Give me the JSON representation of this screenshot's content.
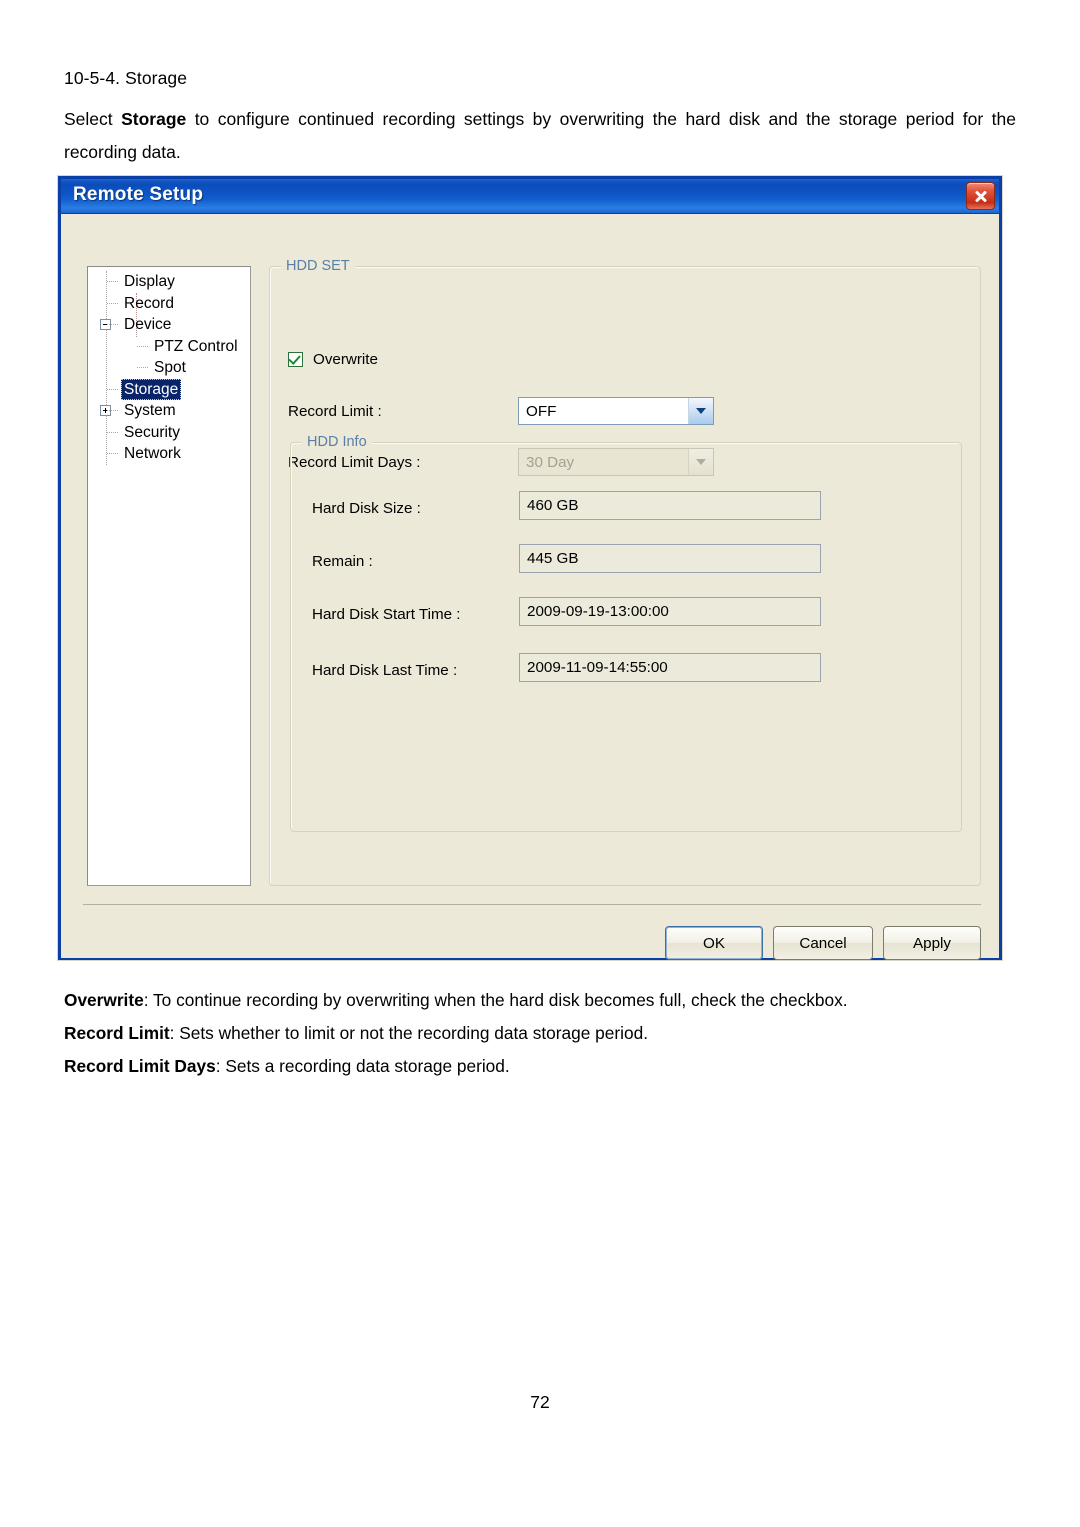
{
  "document": {
    "heading": "10-5-4. Storage",
    "intro_before": "Select ",
    "intro_bold": "Storage",
    "intro_after": " to configure continued recording settings by overwriting the hard disk and the storage period for the recording data.",
    "page_number": "72",
    "notes": [
      {
        "term": "Overwrite",
        "text": ": To continue recording by overwriting when the hard disk becomes full, check the checkbox."
      },
      {
        "term": "Record Limit",
        "text": ": Sets whether to limit or not the recording data storage period."
      },
      {
        "term": "Record Limit Days",
        "text": ": Sets a recording data storage period."
      }
    ]
  },
  "dialog": {
    "title": "Remote Setup",
    "close_icon": "close-icon",
    "tree": {
      "items": [
        {
          "label": "Display",
          "level": 1,
          "expander": "none",
          "selected": false
        },
        {
          "label": "Record",
          "level": 1,
          "expander": "none",
          "selected": false
        },
        {
          "label": "Device",
          "level": 1,
          "expander": "collapse",
          "selected": false
        },
        {
          "label": "PTZ Control",
          "level": 2,
          "expander": "none",
          "selected": false
        },
        {
          "label": "Spot",
          "level": 2,
          "expander": "none",
          "selected": false
        },
        {
          "label": "Storage",
          "level": 1,
          "expander": "none",
          "selected": true
        },
        {
          "label": "System",
          "level": 1,
          "expander": "expand",
          "selected": false
        },
        {
          "label": "Security",
          "level": 1,
          "expander": "none",
          "selected": false
        },
        {
          "label": "Network",
          "level": 1,
          "expander": "none",
          "selected": false
        }
      ]
    },
    "hdd_set": {
      "title": "HDD SET",
      "overwrite": {
        "label": "Overwrite",
        "checked": true
      },
      "record_limit": {
        "label": "Record Limit :",
        "value": "OFF",
        "enabled": true
      },
      "record_limit_days": {
        "label": "Record Limit Days :",
        "value": "30 Day",
        "enabled": false
      }
    },
    "hdd_info": {
      "title": "HDD Info",
      "rows": [
        {
          "label": "Hard Disk Size :",
          "value": "460 GB"
        },
        {
          "label": "Remain :",
          "value": "445 GB"
        },
        {
          "label": "Hard Disk Start Time :",
          "value": "2009-09-19-13:00:00"
        },
        {
          "label": "Hard Disk Last Time :",
          "value": "2009-11-09-14:55:00"
        }
      ]
    },
    "buttons": {
      "ok": "OK",
      "cancel": "Cancel",
      "apply": "Apply"
    }
  },
  "colors": {
    "titlebar_blue": "#0e55c6",
    "dialog_border": "#0b3fa8",
    "dialog_face": "#ece9d8",
    "group_label": "#5a7fa8",
    "selection": "#0a246a",
    "check_green": "#1c8b2e"
  }
}
